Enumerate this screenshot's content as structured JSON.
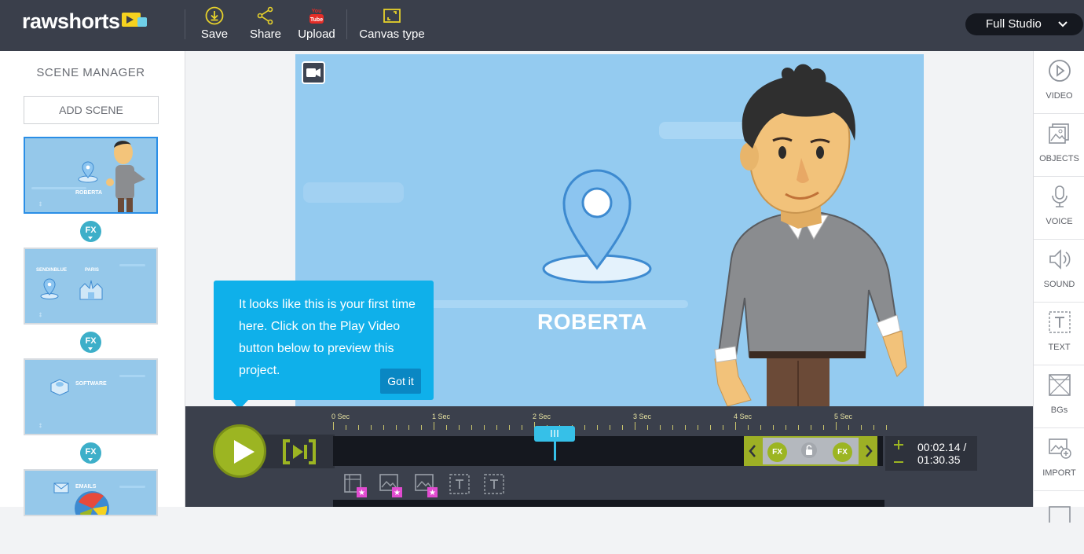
{
  "app": {
    "logo": "rawshorts"
  },
  "toolbar": {
    "save": "Save",
    "share": "Share",
    "upload": "Upload",
    "upload_badge": "You Tube",
    "canvas_type": "Canvas type",
    "studio_mode": "Full Studio"
  },
  "sidebar": {
    "title": "SCENE MANAGER",
    "add_scene": "ADD SCENE",
    "scenes": [
      {
        "label": "ROBERTA",
        "fx": "FX"
      },
      {
        "label_left": "SENDINBLUE",
        "label_right": "PARIS",
        "fx": "FX"
      },
      {
        "label": "SOFTWARE",
        "fx": "FX"
      },
      {
        "label": "EMAILS"
      }
    ]
  },
  "canvas": {
    "name": "ROBERTA"
  },
  "tooltip": {
    "text": "It looks like this is your first time here. Click on the Play Video button below to preview this project.",
    "button": "Got it"
  },
  "timeline": {
    "ticks": [
      "0 Sec",
      "1 Sec",
      "2 Sec",
      "3 Sec",
      "4 Sec",
      "5 Sec"
    ],
    "fx_left": "FX",
    "fx_right": "FX",
    "time_current": "00:02.14 /",
    "time_total": "01:30.35"
  },
  "rightbar": {
    "items": [
      "VIDEO",
      "OBJECTS",
      "VOICE",
      "SOUND",
      "TEXT",
      "BGs",
      "IMPORT"
    ]
  }
}
